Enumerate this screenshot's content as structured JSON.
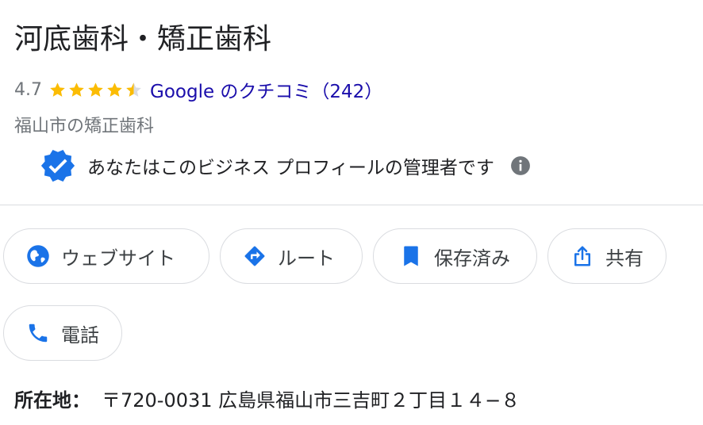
{
  "business": {
    "name": "河底歯科・矯正歯科",
    "rating": "4.7",
    "stars": 4.5,
    "reviews_label": "Google のクチコミ（242）",
    "category": "福山市の矯正歯科",
    "verified_text": "あなたはこのビジネス プロフィールの管理者です"
  },
  "actions": {
    "website": "ウェブサイト",
    "route": "ルート",
    "saved": "保存済み",
    "share": "共有",
    "phone": "電話"
  },
  "address": {
    "label": "所在地：",
    "value": "〒720-0031 広島県福山市三吉町２丁目１４−８"
  },
  "icons": {
    "website": "globe-icon",
    "route": "directions-icon",
    "saved": "bookmark-icon",
    "share": "share-icon",
    "phone": "phone-icon",
    "verified": "verified-badge-icon",
    "info": "info-icon"
  },
  "colors": {
    "accent_blue": "#1a73e8",
    "link_blue": "#1a0dab",
    "star_gold": "#fbbc04",
    "muted_text": "#70757a"
  }
}
